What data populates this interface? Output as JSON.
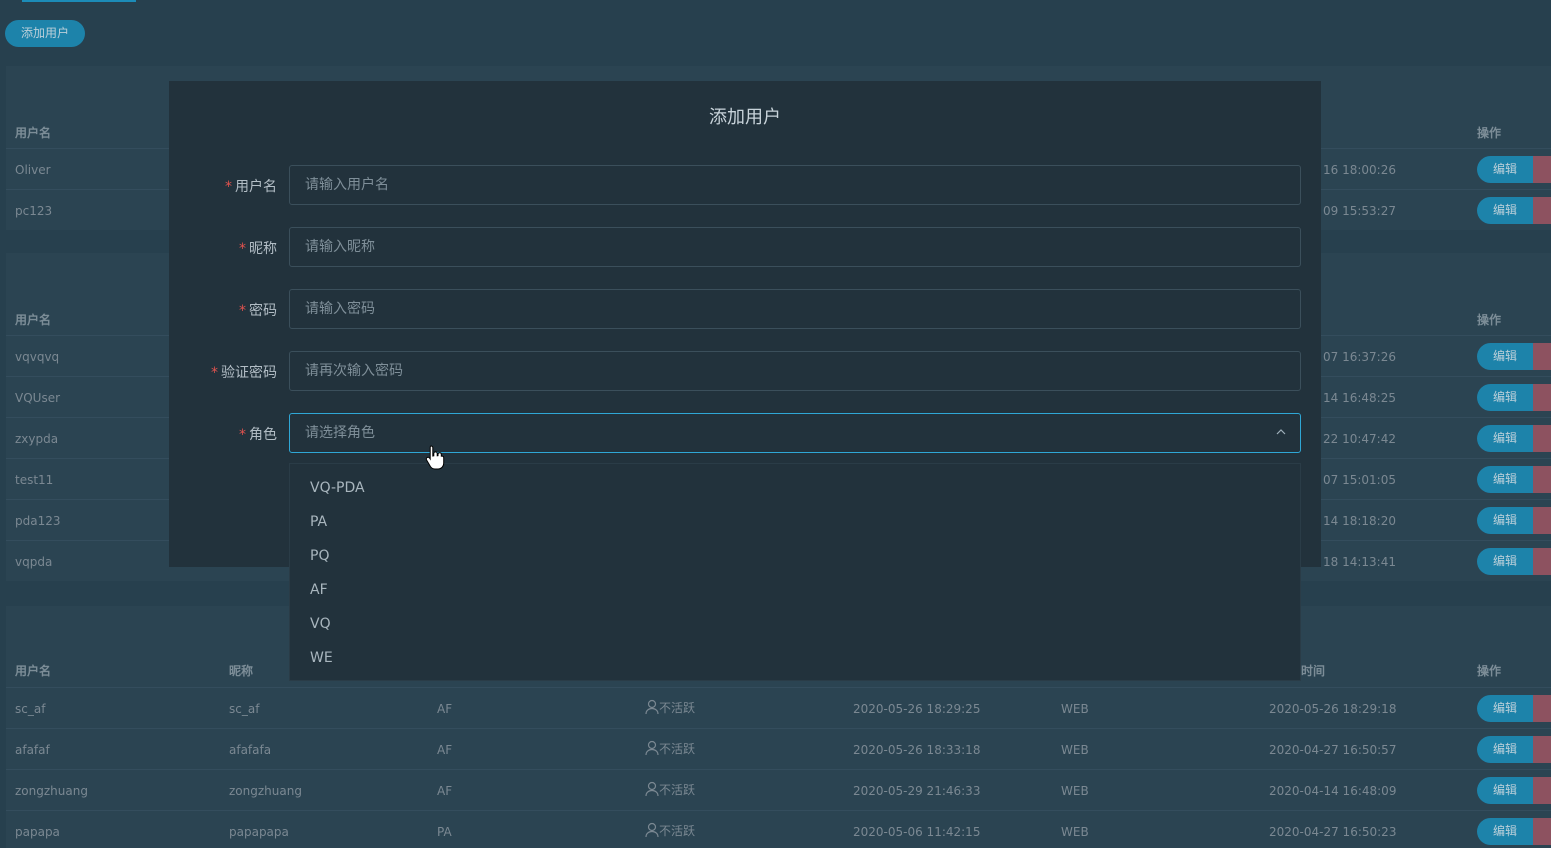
{
  "toolbar": {
    "add_user": "添加用户"
  },
  "table_headers": {
    "username": "用户名",
    "nickname": "昵称",
    "time_frag": "时间",
    "actions": "操作"
  },
  "row_actions": {
    "edit": "编辑"
  },
  "panel1": {
    "rows": [
      {
        "username": "Oliver",
        "time": "16 18:00:26"
      },
      {
        "username": "pc123",
        "time": "09 15:53:27"
      }
    ]
  },
  "panel2": {
    "rows": [
      {
        "username": "vqvqvq",
        "time": "07 16:37:26"
      },
      {
        "username": "VQUser",
        "time": "14 16:48:25"
      },
      {
        "username": "zxypda",
        "time": "22 10:47:42"
      },
      {
        "username": "test11",
        "time": "07 15:01:05"
      },
      {
        "username": "pda123",
        "time": "14 18:18:20"
      },
      {
        "username": "vqpda",
        "time": "18 14:13:41"
      }
    ]
  },
  "panel3": {
    "rows": [
      {
        "username": "sc_af",
        "nickname": "sc_af",
        "role": "AF",
        "status": "不活跃",
        "created": "2020-05-26 18:29:25",
        "platform": "WEB",
        "updated": "2020-05-26 18:29:18"
      },
      {
        "username": "afafaf",
        "nickname": "afafafa",
        "role": "AF",
        "status": "不活跃",
        "created": "2020-05-26 18:33:18",
        "platform": "WEB",
        "updated": "2020-04-27 16:50:57"
      },
      {
        "username": "zongzhuang",
        "nickname": "zongzhuang",
        "role": "AF",
        "status": "不活跃",
        "created": "2020-05-29 21:46:33",
        "platform": "WEB",
        "updated": "2020-04-14 16:48:09"
      },
      {
        "username": "papapa",
        "nickname": "papapapa",
        "role": "PA",
        "status": "不活跃",
        "created": "2020-05-06 11:42:15",
        "platform": "WEB",
        "updated": "2020-04-27 16:50:23"
      }
    ]
  },
  "modal": {
    "title": "添加用户",
    "fields": [
      {
        "label": "用户名",
        "placeholder": "请输入用户名"
      },
      {
        "label": "昵称",
        "placeholder": "请输入昵称"
      },
      {
        "label": "密码",
        "placeholder": "请输入密码"
      },
      {
        "label": "验证密码",
        "placeholder": "请再次输入密码"
      },
      {
        "label": "角色",
        "placeholder": "请选择角色"
      }
    ],
    "role_options": [
      "VQ-PDA",
      "PA",
      "PQ",
      "AF",
      "VQ",
      "WE"
    ]
  }
}
